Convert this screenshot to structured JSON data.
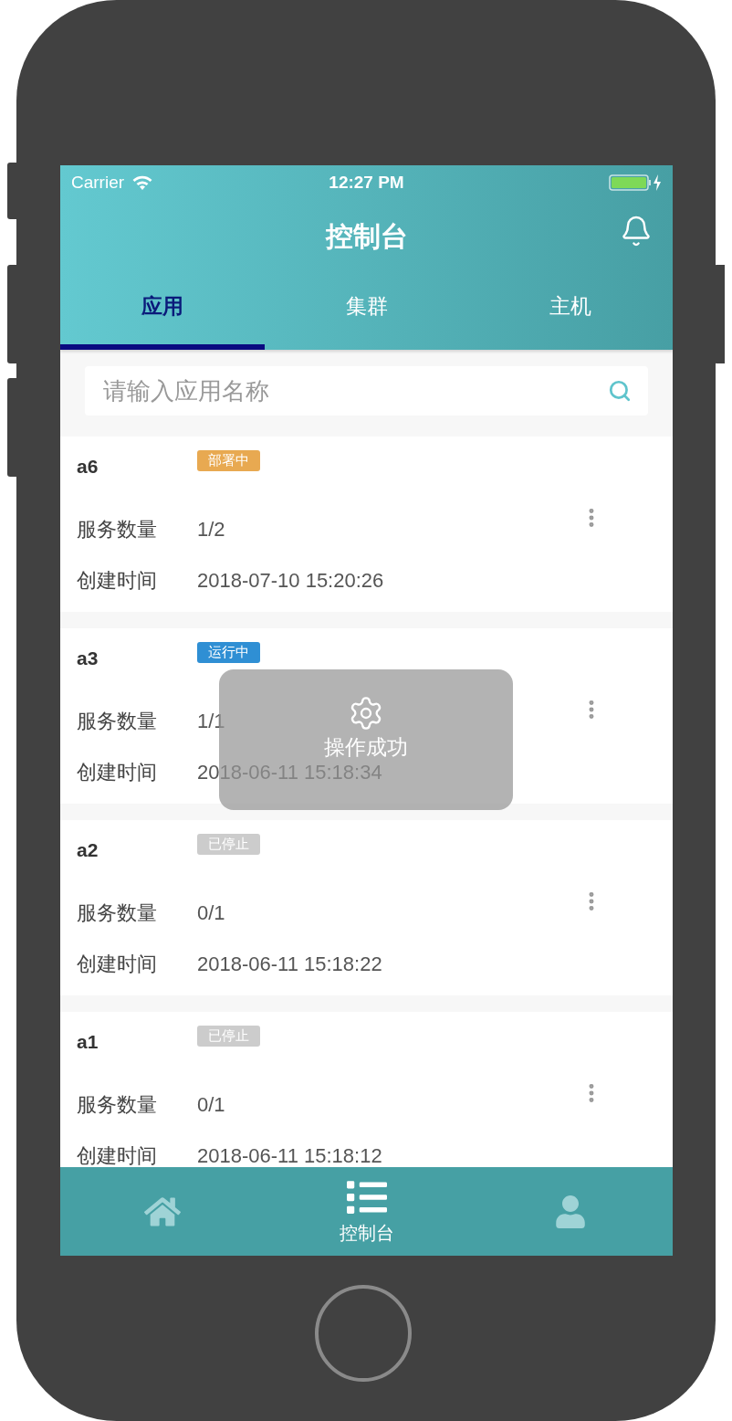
{
  "status_bar": {
    "carrier": "Carrier",
    "time": "12:27 PM"
  },
  "header": {
    "title": "控制台"
  },
  "tabs": [
    {
      "label": "应用",
      "selected": true
    },
    {
      "label": "集群",
      "selected": false
    },
    {
      "label": "主机",
      "selected": false
    }
  ],
  "search": {
    "placeholder": "请输入应用名称"
  },
  "apps": [
    {
      "name": "a6",
      "status": {
        "label": "部署中",
        "color": "#e8a951"
      },
      "fields": [
        {
          "label": "服务数量",
          "value": "1/2"
        },
        {
          "label": "创建时间",
          "value": "2018-07-10 15:20:26"
        }
      ]
    },
    {
      "name": "a3",
      "status": {
        "label": "运行中",
        "color": "#2f8fd4"
      },
      "fields": [
        {
          "label": "服务数量",
          "value": "1/1"
        },
        {
          "label": "创建时间",
          "value": "2018-06-11 15:18:34"
        }
      ]
    },
    {
      "name": "a2",
      "status": {
        "label": "已停止",
        "color": "#cccccc"
      },
      "fields": [
        {
          "label": "服务数量",
          "value": "0/1"
        },
        {
          "label": "创建时间",
          "value": "2018-06-11 15:18:22"
        }
      ]
    },
    {
      "name": "a1",
      "status": {
        "label": "已停止",
        "color": "#cccccc"
      },
      "fields": [
        {
          "label": "服务数量",
          "value": "0/1"
        },
        {
          "label": "创建时间",
          "value": "2018-06-11 15:18:12"
        }
      ]
    }
  ],
  "toast": {
    "message": "操作成功"
  },
  "bottom_nav": [
    {
      "kind": "home",
      "selected": false
    },
    {
      "kind": "console",
      "label": "控制台",
      "selected": true
    },
    {
      "kind": "profile",
      "selected": false
    }
  ]
}
